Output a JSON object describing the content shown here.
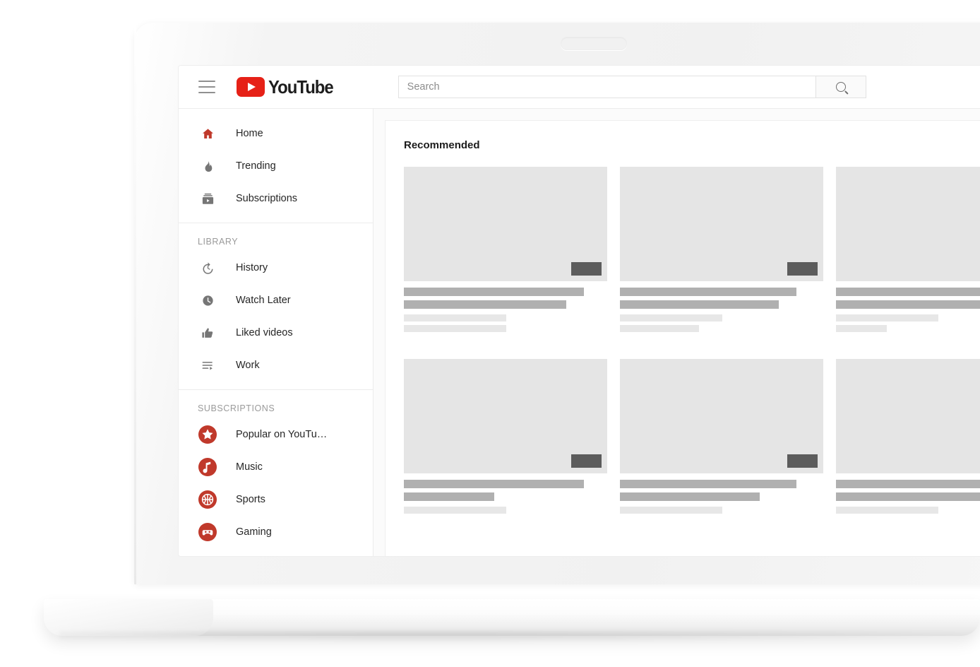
{
  "device": {
    "type": "laptop-mockup",
    "camera_slot": "speaker-slot"
  },
  "app": {
    "brand": "YouTube",
    "brand_color": "#e62117"
  },
  "topbar": {
    "menu_icon": "hamburger-menu-icon",
    "logo_play_icon": "youtube-play-icon",
    "logo_text": "YouTube",
    "search": {
      "placeholder": "Search",
      "value": "",
      "button_icon": "search-icon"
    }
  },
  "sidebar": {
    "primary": [
      {
        "label": "Home",
        "icon": "home-icon",
        "icon_color": "#c0392b",
        "glyph": "⌂"
      },
      {
        "label": "Trending",
        "icon": "flame-icon",
        "icon_color": "#767676",
        "glyph": "🔥"
      },
      {
        "label": "Subscriptions",
        "icon": "subscriptions-icon",
        "icon_color": "#767676",
        "glyph": "▤"
      }
    ],
    "library": {
      "heading": "LIBRARY",
      "items": [
        {
          "label": "History",
          "icon": "history-clock-icon",
          "icon_color": "#767676",
          "glyph": "↺"
        },
        {
          "label": "Watch Later",
          "icon": "watch-later-clock-icon",
          "icon_color": "#767676",
          "glyph": "🕑"
        },
        {
          "label": "Liked videos",
          "icon": "thumbs-up-icon",
          "icon_color": "#767676",
          "glyph": "👍"
        },
        {
          "label": "Work",
          "icon": "playlist-icon",
          "icon_color": "#767676",
          "glyph": "≡"
        }
      ]
    },
    "subscriptions": {
      "heading": "SUBSCRIPTIONS",
      "items": [
        {
          "label": "Popular on YouTu…",
          "icon": "star-channel-icon",
          "glyph": "★",
          "color": "#c0392b"
        },
        {
          "label": "Music",
          "icon": "music-note-channel-icon",
          "glyph": "♪",
          "color": "#c0392b"
        },
        {
          "label": "Sports",
          "icon": "basketball-channel-icon",
          "glyph": "●",
          "color": "#c0392b"
        },
        {
          "label": "Gaming",
          "icon": "gamepad-channel-icon",
          "glyph": "▬",
          "color": "#c0392b"
        }
      ]
    }
  },
  "main": {
    "section_title": "Recommended",
    "placeholder_colors": {
      "thumbnail": "#e5e5e5",
      "duration_badge": "#5c5c5c",
      "title_bar": "#b0b0b0",
      "meta_bar": "#e7e7e7"
    },
    "rows": [
      {
        "cards": [
          {
            "title_widths": [
              255,
              230
            ],
            "meta_widths": [
              145,
              145
            ],
            "duration_badge": true
          },
          {
            "title_widths": [
              250,
              225
            ],
            "meta_widths": [
              145,
              112
            ],
            "duration_badge": true
          },
          {
            "title_widths": [
              255,
              230
            ],
            "meta_widths": [
              145,
              72
            ],
            "duration_badge": true
          }
        ]
      },
      {
        "cards": [
          {
            "title_widths": [
              255,
              128
            ],
            "meta_widths": [
              145,
              0
            ],
            "duration_badge": true
          },
          {
            "title_widths": [
              250,
              198
            ],
            "meta_widths": [
              145,
              0
            ],
            "duration_badge": true
          },
          {
            "title_widths": [
              255,
              230
            ],
            "meta_widths": [
              145,
              0
            ],
            "duration_badge": true
          }
        ]
      }
    ]
  }
}
